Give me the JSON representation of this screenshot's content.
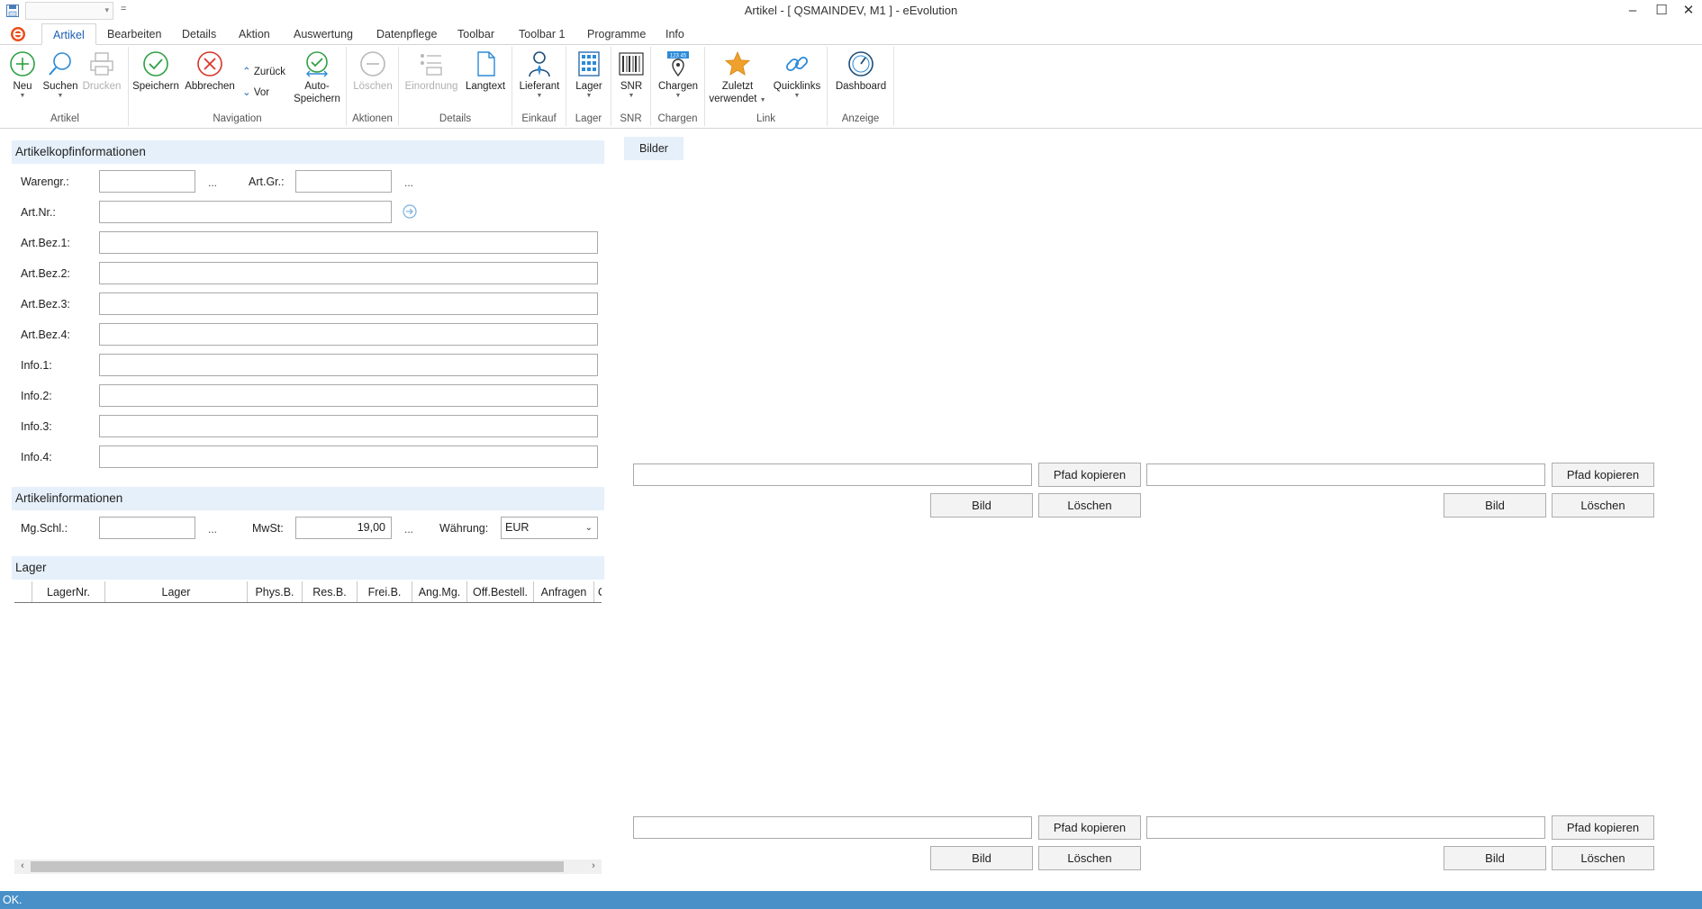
{
  "window": {
    "title": "Artikel - [ QSMAINDEV, M1 ]  -  eEvolution",
    "minimize": "–",
    "maximize": "☐",
    "close": "✕",
    "quick_access_more": "="
  },
  "tabs": [
    "Artikel",
    "Bearbeiten",
    "Details",
    "Aktion",
    "Auswertung",
    "Datenpflege",
    "Toolbar",
    "Toolbar 1",
    "Programme",
    "Info"
  ],
  "ribbon": {
    "groups": {
      "artikel": "Artikel",
      "navigation": "Navigation",
      "aktionen": "Aktionen",
      "details": "Details",
      "einkauf": "Einkauf",
      "lager": "Lager",
      "snr": "SNR",
      "chargen": "Chargen",
      "link": "Link",
      "anzeige": "Anzeige"
    },
    "buttons": {
      "neu": "Neu",
      "suchen": "Suchen",
      "drucken": "Drucken",
      "speichern": "Speichern",
      "abbrechen": "Abbrechen",
      "zurueck": "Zurück",
      "vor": "Vor",
      "auto_speichern_1": "Auto-",
      "auto_speichern_2": "Speichern",
      "loeschen": "Löschen",
      "einordnung": "Einordnung",
      "langtext": "Langtext",
      "lieferant": "Lieferant",
      "lager": "Lager",
      "snr": "SNR",
      "chargen": "Chargen",
      "chargen_icon_text": "123 45",
      "zuletzt_1": "Zuletzt",
      "zuletzt_2": "verwendet",
      "quicklinks": "Quicklinks",
      "dashboard": "Dashboard"
    }
  },
  "artikelkopf": {
    "header": "Artikelkopfinformationen",
    "warengr_label": "Warengr.:",
    "warengr_value": "",
    "artgr_label": "Art.Gr.:",
    "artgr_value": "",
    "artnr_label": "Art.Nr.:",
    "artnr_value": "",
    "artbez1_label": "Art.Bez.1:",
    "artbez2_label": "Art.Bez.2:",
    "artbez3_label": "Art.Bez.3:",
    "artbez4_label": "Art.Bez.4:",
    "info1_label": "Info.1:",
    "info2_label": "Info.2:",
    "info3_label": "Info.3:",
    "info4_label": "Info.4:",
    "dots": "..."
  },
  "artikelinfo": {
    "header": "Artikelinformationen",
    "mgschl_label": "Mg.Schl.:",
    "mgschl_value": "",
    "mwst_label": "MwSt:",
    "mwst_value": "19,00",
    "waehrung_label": "Währung:",
    "waehrung_value": "EUR"
  },
  "lager": {
    "header": "Lager",
    "columns": [
      "LagerNr.",
      "Lager",
      "Phys.B.",
      "Res.B.",
      "Frei.B.",
      "Ang.Mg.",
      "Off.Bestell.",
      "Anfragen",
      "Of"
    ],
    "rows": []
  },
  "bilder": {
    "tab_label": "Bilder",
    "pfad_kopieren": "Pfad kopieren",
    "bild": "Bild",
    "loeschen": "Löschen"
  },
  "status": {
    "text": "OK."
  },
  "colors": {
    "accent": "#1a5fb4",
    "section_bg": "#e6f0fa",
    "statusbar": "#4a90c8",
    "green": "#2ea043",
    "red": "#d9342b",
    "star": "#f0a02c"
  }
}
